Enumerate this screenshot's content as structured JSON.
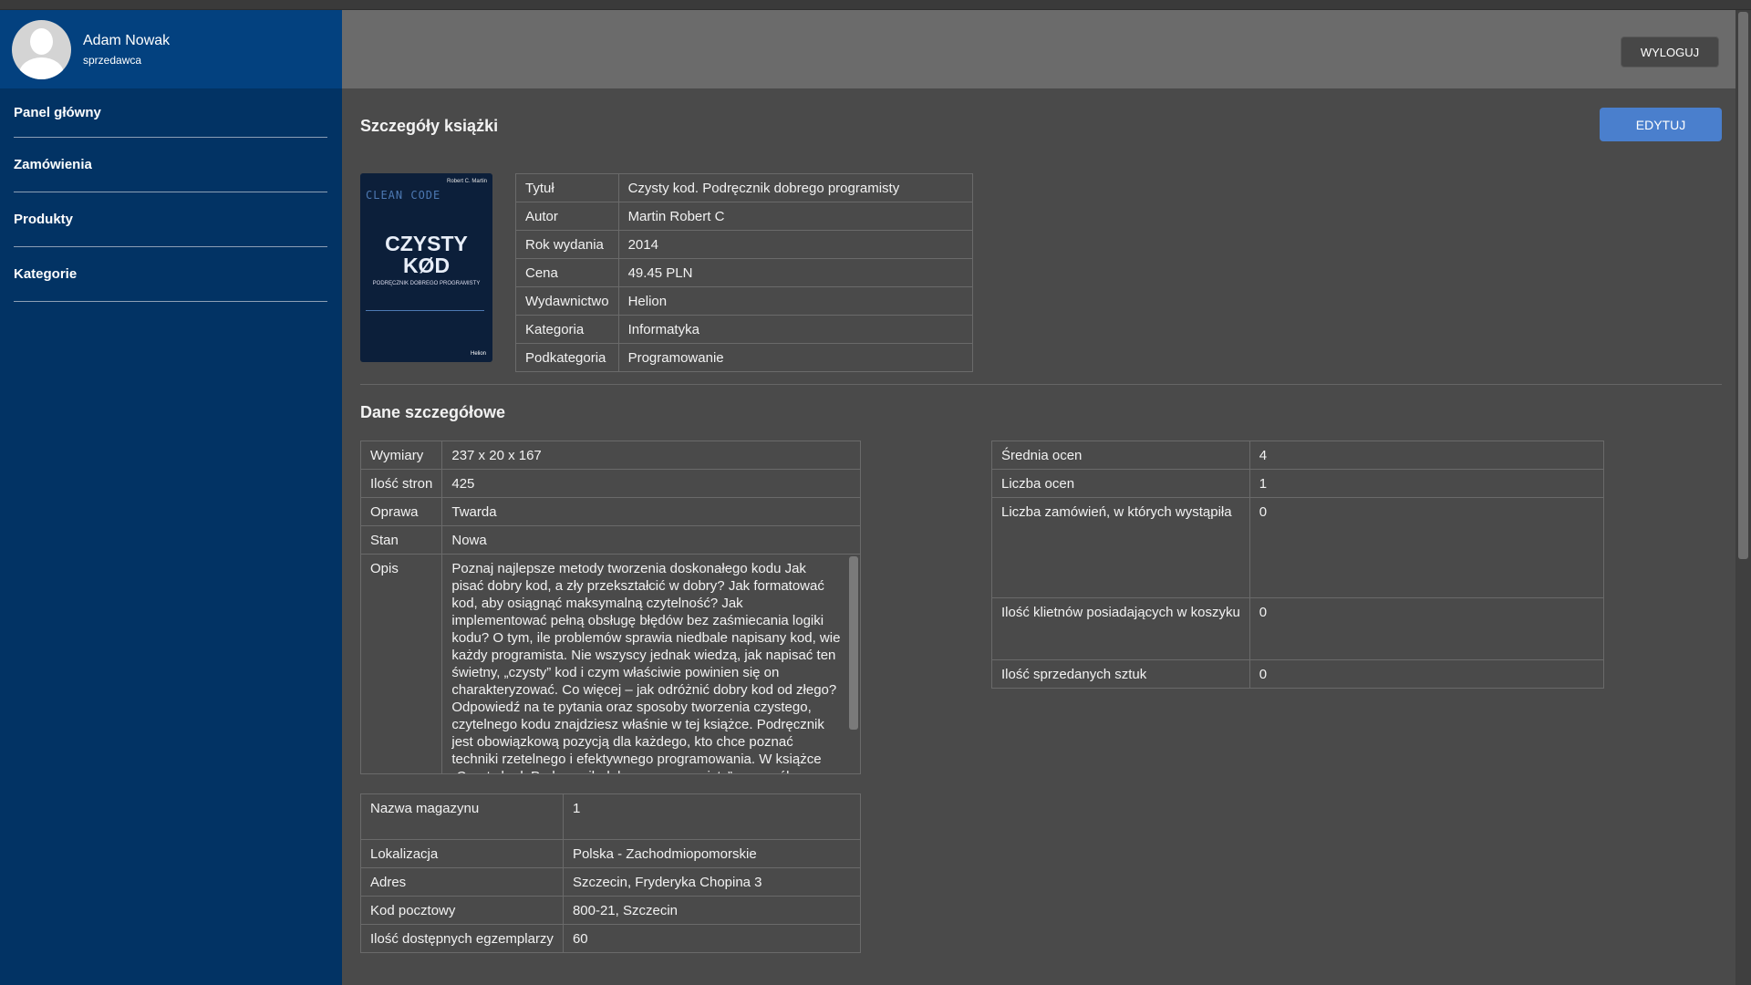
{
  "user": {
    "name": "Adam Nowak",
    "role": "sprzedawca"
  },
  "nav": [
    {
      "label": "Panel główny"
    },
    {
      "label": "Zamówienia"
    },
    {
      "label": "Produkty"
    },
    {
      "label": "Kategorie"
    }
  ],
  "header": {
    "logout_label": "WYLOGUJ"
  },
  "page": {
    "title": "Szczegóły książki",
    "edit_label": "EDYTUJ"
  },
  "cover": {
    "author": "Robert C. Martin",
    "bg_text": "CLEAN CODE",
    "title_line1": "CZYSTY",
    "title_line2": "KØD",
    "subtitle": "PODRĘCZNIK DOBREGO PROGRAMISTY",
    "publisher": "Helion"
  },
  "basic": [
    {
      "label": "Tytuł",
      "value": "Czysty kod. Podręcznik dobrego programisty"
    },
    {
      "label": "Autor",
      "value": "Martin Robert C"
    },
    {
      "label": "Rok wydania",
      "value": "2014"
    },
    {
      "label": "Cena",
      "value": "49.45 PLN"
    },
    {
      "label": "Wydawnictwo",
      "value": "Helion"
    },
    {
      "label": "Kategoria",
      "value": "Informatyka"
    },
    {
      "label": "Podkategoria",
      "value": "Programowanie"
    }
  ],
  "section_details_title": "Dane szczegółowe",
  "details": [
    {
      "label": "Wymiary",
      "value": "237 x 20 x 167"
    },
    {
      "label": "Ilość stron",
      "value": "425"
    },
    {
      "label": "Oprawa",
      "value": "Twarda"
    },
    {
      "label": "Stan",
      "value": "Nowa"
    }
  ],
  "description": {
    "label": "Opis",
    "value": "Poznaj najlepsze metody tworzenia doskonałego kodu Jak pisać dobry kod, a zły przekształcić w dobry? Jak formatować kod, aby osiągnąć maksymalną czytelność? Jak implementować pełną obsługę błędów bez zaśmiecania logiki kodu? O tym, ile problemów sprawia niedbale napisany kod, wie każdy programista. Nie wszyscy jednak wiedzą, jak napisać ten świetny, „czysty” kod i czym właściwie powinien się on charakteryzować. Co więcej – jak odróżnić dobry kod od złego? Odpowiedź na te pytania oraz sposoby tworzenia czystego, czytelnego kodu znajdziesz właśnie w tej książce. Podręcznik jest obowiązkową pozycją dla każdego, kto chce poznać techniki rzetelnego i efektywnego programowania. W książce „Czysty kod. Podręcznik dobrego programisty” szczegółowo omówione zostały zasady, wzorce i najlepsze praktyki pisania"
  },
  "stats": [
    {
      "label": "Średnia ocen",
      "value": "4"
    },
    {
      "label": "Liczba ocen",
      "value": "1"
    },
    {
      "label": "Liczba zamówień, w których wystąpiła",
      "value": "0"
    },
    {
      "label": "Ilość klietnów posiadających w koszyku",
      "value": "0"
    },
    {
      "label": "Ilość sprzedanych sztuk",
      "value": "0"
    }
  ],
  "warehouse": [
    {
      "label": "Nazwa magazynu",
      "value": "1"
    },
    {
      "label": "Lokalizacja",
      "value": "Polska - Zachodmiopomorskie"
    },
    {
      "label": "Adres",
      "value": "Szczecin, Fryderyka Chopina 3"
    },
    {
      "label": "Kod pocztowy",
      "value": "800-21, Szczecin"
    },
    {
      "label": "Ilość dostępnych egzemplarzy",
      "value": "60"
    }
  ]
}
